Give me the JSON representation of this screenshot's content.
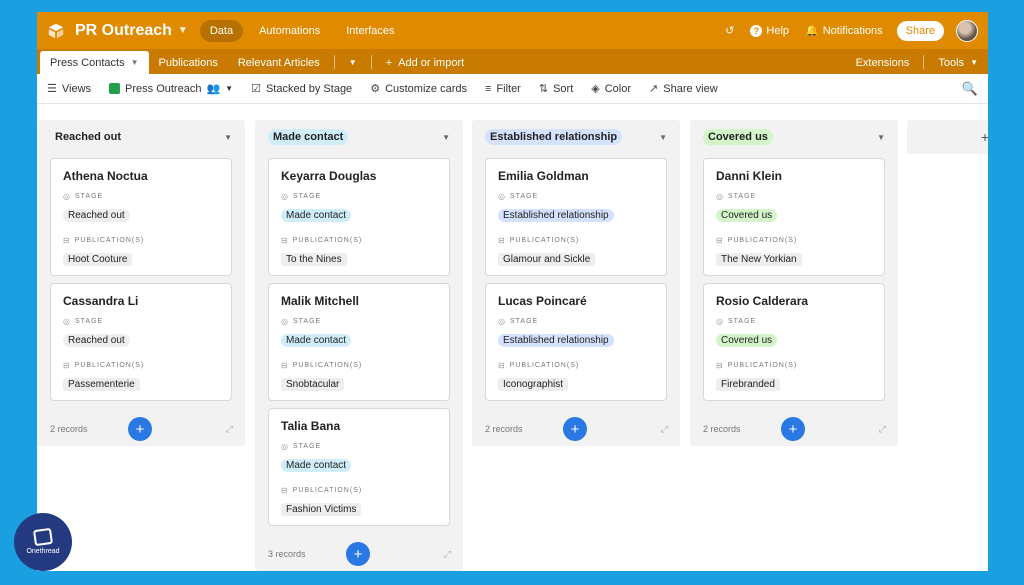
{
  "colors": {
    "frame_bg": "#1a9fe0",
    "topbar": "#e08a00",
    "tabbar": "#c87b00",
    "add_button": "#2a78e4"
  },
  "topbar": {
    "title": "PR Outreach",
    "nav": [
      "Data",
      "Automations",
      "Interfaces"
    ],
    "active_nav": "Data",
    "help": "Help",
    "notifications": "Notifications",
    "share": "Share"
  },
  "tabs": {
    "items": [
      "Press Contacts",
      "Publications",
      "Relevant Articles"
    ],
    "add": "Add or import",
    "extensions": "Extensions",
    "tools": "Tools"
  },
  "toolbar": {
    "views": "Views",
    "view_name": "Press Outreach",
    "stacked": "Stacked by Stage",
    "customize": "Customize cards",
    "filter": "Filter",
    "sort": "Sort",
    "color": "Color",
    "share_view": "Share view"
  },
  "field_labels": {
    "stage": "STAGE",
    "publications": "PUBLICATION(S)"
  },
  "columns": [
    {
      "label": "Reached out",
      "color": "#f2f2f2",
      "footer": "2 records",
      "cards": [
        {
          "name": "Athena Noctua",
          "stage": "Reached out",
          "publication": "Hoot Cooture"
        },
        {
          "name": "Cassandra Li",
          "stage": "Reached out",
          "publication": "Passementerie"
        }
      ]
    },
    {
      "label": "Made contact",
      "color": "#cfeefa",
      "footer": "3 records",
      "cards": [
        {
          "name": "Keyarra Douglas",
          "stage": "Made contact",
          "publication": "To the Nines"
        },
        {
          "name": "Malik Mitchell",
          "stage": "Made contact",
          "publication": "Snobtacular"
        },
        {
          "name": "Talia Bana",
          "stage": "Made contact",
          "publication": "Fashion Victims"
        }
      ]
    },
    {
      "label": "Established relationship",
      "color": "#d4e2ff",
      "footer": "2 records",
      "cards": [
        {
          "name": "Emilia Goldman",
          "stage": "Established relationship",
          "publication": "Glamour and Sickle"
        },
        {
          "name": "Lucas Poincaré",
          "stage": "Established relationship",
          "publication": "Iconographist"
        }
      ]
    },
    {
      "label": "Covered us",
      "color": "#d3f5c9",
      "footer": "2 records",
      "cards": [
        {
          "name": "Danni Klein",
          "stage": "Covered us",
          "publication": "The New Yorkian"
        },
        {
          "name": "Rosio Calderara",
          "stage": "Covered us",
          "publication": "Firebranded"
        }
      ]
    }
  ],
  "watermark": "Onethread"
}
